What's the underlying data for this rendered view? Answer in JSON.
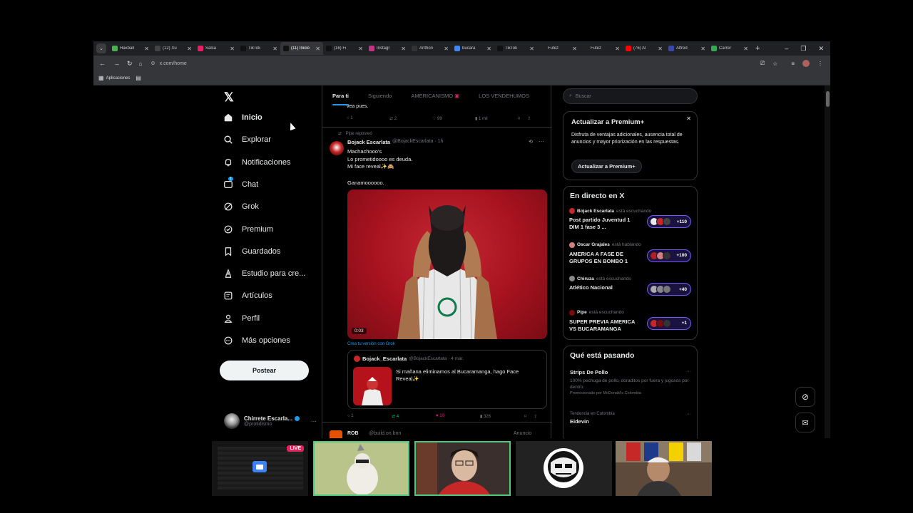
{
  "browser": {
    "tabs": [
      {
        "label": "Haxball",
        "color": "#4caf50",
        "active": false
      },
      {
        "label": "(12) Xu",
        "color": "#444444",
        "active": false
      },
      {
        "label": "Salsa",
        "color": "#e91e63",
        "active": false
      },
      {
        "label": "TikTok",
        "color": "#111111",
        "active": false
      },
      {
        "label": "(11) Inicio",
        "color": "#111111",
        "active": true
      },
      {
        "label": "(16) Fi",
        "color": "#111111",
        "active": false
      },
      {
        "label": "Instagr",
        "color": "#c13584",
        "active": false
      },
      {
        "label": "Anthon",
        "color": "#333333",
        "active": false
      },
      {
        "label": "bucara",
        "color": "#4285f4",
        "active": false
      },
      {
        "label": "TikTok",
        "color": "#111111",
        "active": false
      },
      {
        "label": "Futez",
        "color": "#222222",
        "active": false
      },
      {
        "label": "Futez",
        "color": "#222222",
        "active": false
      },
      {
        "label": "(76) Al",
        "color": "#ff0000",
        "active": false
      },
      {
        "label": "Alfred",
        "color": "#3949ab",
        "active": false
      },
      {
        "label": "Carrer",
        "color": "#34a853",
        "active": false
      }
    ],
    "url": "x.com/home",
    "bookmarks_label": "Aplicaciones"
  },
  "sidebar": {
    "items": [
      {
        "label": "Inicio",
        "icon": "home-icon",
        "bold": true
      },
      {
        "label": "Explorar",
        "icon": "search-icon"
      },
      {
        "label": "Notificaciones",
        "icon": "bell-icon"
      },
      {
        "label": "Chat",
        "icon": "chat-icon"
      },
      {
        "label": "Grok",
        "icon": "grok-icon"
      },
      {
        "label": "Premium",
        "icon": "premium-icon"
      },
      {
        "label": "Guardados",
        "icon": "bookmark-icon"
      },
      {
        "label": "Estudio para cre...",
        "icon": "creator-icon"
      },
      {
        "label": "Artículos",
        "icon": "articles-icon"
      },
      {
        "label": "Perfil",
        "icon": "profile-icon"
      },
      {
        "label": "Más opciones",
        "icon": "more-icon"
      }
    ],
    "chat_badge": "1",
    "post_button": "Postear",
    "account": {
      "name": "Chirrete Escarla...",
      "handle": "@protidismo"
    }
  },
  "feed": {
    "tabs": [
      "Para ti",
      "Siguiendo",
      "AMERICANISMO",
      "LOS VENDEHUMOS"
    ],
    "prev_post": {
      "tail_text": "vea pues.",
      "reply": "1",
      "repost": "2",
      "like": "99",
      "views": "1 mil"
    },
    "post": {
      "reposted_by": "Pipe reposteó",
      "author": "Bojack Escarlata",
      "handle": "@BojackEscarlata · 1h",
      "lines": [
        "Machachooo's",
        "Lo prometidoooo es deuda.",
        "Mi face reveal✨🙈",
        "Ganamoooooo."
      ],
      "video_time": "0:03",
      "grok_link": "Crea tu versión con Grok",
      "quoted": {
        "author": "Bojack_Escarlata",
        "handle": "@BojackEscarlata · 4 mar.",
        "text": "Si mañana eliminamos al Bucaramanga, hago Face Reveal✨"
      },
      "reply": "1",
      "repost": "4",
      "like": "10",
      "views": "326"
    },
    "next_post": {
      "author": "ROB",
      "handle": "@build.on.bnn",
      "ad": "Anuncio"
    }
  },
  "right": {
    "search_placeholder": "Buscar",
    "premium": {
      "title": "Actualizar a Premium+",
      "text": "Disfruta de ventajas adicionales, ausencia total de anuncios y mayor priorización en las respuestas.",
      "button": "Actualizar a Premium+"
    },
    "live": {
      "title": "En directo en X",
      "items": [
        {
          "host": "Bojack Escarlata",
          "status": "está escuchando",
          "title": "Post partido Juventud 1 DIM 1 fase 3 ...",
          "count": "+110"
        },
        {
          "host": "Oscar Grajales",
          "status": "está hablando",
          "title": "AMERICA A FASE DE GRUPOS EN BOMBO 1",
          "count": "+100"
        },
        {
          "host": "Chiruza",
          "status": "está escuchando",
          "title": "Atlético Nacional",
          "count": "+40"
        },
        {
          "host": "Pipe",
          "status": "está escuchando",
          "title": "SUPER PREVIA AMERICA VS BUCARAMANGA",
          "count": "+1"
        }
      ]
    },
    "trending": {
      "title": "Qué está pasando",
      "items": [
        {
          "title": "Strips De Pollo",
          "sub": "100% pechuga de pollo, doraditos por fuera y jugosos por dentro.",
          "meta": "Promocionado por McDonald's Colombia"
        },
        {
          "meta": "Tendencia en Colombia",
          "title": "Eidevin"
        }
      ]
    }
  },
  "stream": {
    "live_badge": "LIVE"
  },
  "colors": {
    "accent": "#1d9bf0",
    "live_red": "#e0245e",
    "grok_purple": "#7856ff",
    "video_red": "#b5121b"
  }
}
